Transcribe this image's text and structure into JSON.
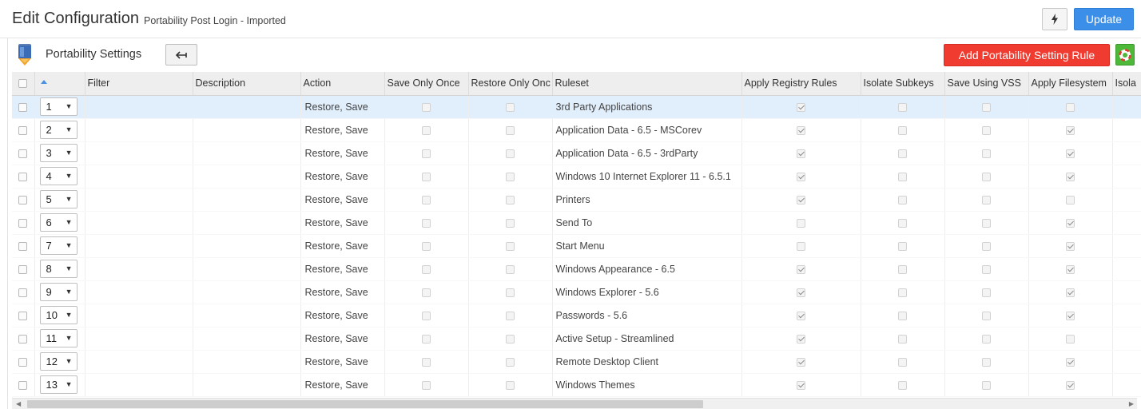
{
  "header": {
    "title": "Edit Configuration",
    "subtitle": "Portability Post Login - Imported",
    "update_label": "Update"
  },
  "sub_header": {
    "title": "Portability Settings",
    "add_rule_label": "Add Portability Setting Rule"
  },
  "icons": {
    "bolt": "bolt-icon",
    "back": "back-arrow-icon",
    "help": "lifebuoy-icon",
    "settings": "portability-settings-icon"
  },
  "colors": {
    "update": "#3b8fe8",
    "add_rule": "#ef3b30",
    "help": "#4db83a",
    "selected_row": "#e1eefb"
  },
  "table": {
    "columns": [
      "Filter",
      "Description",
      "Action",
      "Save Only Once",
      "Restore Only Onc",
      "Ruleset",
      "Apply Registry Rules",
      "Isolate Subkeys",
      "Save Using VSS",
      "Apply Filesystem",
      "Isola"
    ],
    "rows": [
      {
        "order": "1",
        "action": "Restore, Save",
        "ruleset": "3rd Party Applications",
        "registry": true,
        "filesystem": false
      },
      {
        "order": "2",
        "action": "Restore, Save",
        "ruleset": "Application Data - 6.5 - MSCorev",
        "registry": true,
        "filesystem": true
      },
      {
        "order": "3",
        "action": "Restore, Save",
        "ruleset": "Application Data - 6.5 - 3rdParty",
        "registry": true,
        "filesystem": true
      },
      {
        "order": "4",
        "action": "Restore, Save",
        "ruleset": "Windows 10 Internet Explorer 11 - 6.5.1",
        "registry": true,
        "filesystem": true
      },
      {
        "order": "5",
        "action": "Restore, Save",
        "ruleset": "Printers",
        "registry": true,
        "filesystem": false
      },
      {
        "order": "6",
        "action": "Restore, Save",
        "ruleset": "Send To",
        "registry": false,
        "filesystem": true
      },
      {
        "order": "7",
        "action": "Restore, Save",
        "ruleset": "Start Menu",
        "registry": false,
        "filesystem": true
      },
      {
        "order": "8",
        "action": "Restore, Save",
        "ruleset": "Windows Appearance - 6.5",
        "registry": true,
        "filesystem": true
      },
      {
        "order": "9",
        "action": "Restore, Save",
        "ruleset": "Windows Explorer - 5.6",
        "registry": true,
        "filesystem": true
      },
      {
        "order": "10",
        "action": "Restore, Save",
        "ruleset": "Passwords - 5.6",
        "registry": true,
        "filesystem": true
      },
      {
        "order": "11",
        "action": "Restore, Save",
        "ruleset": "Active Setup - Streamlined",
        "registry": true,
        "filesystem": false
      },
      {
        "order": "12",
        "action": "Restore, Save",
        "ruleset": "Remote Desktop Client",
        "registry": true,
        "filesystem": true
      },
      {
        "order": "13",
        "action": "Restore, Save",
        "ruleset": "Windows Themes",
        "registry": true,
        "filesystem": true
      }
    ]
  }
}
